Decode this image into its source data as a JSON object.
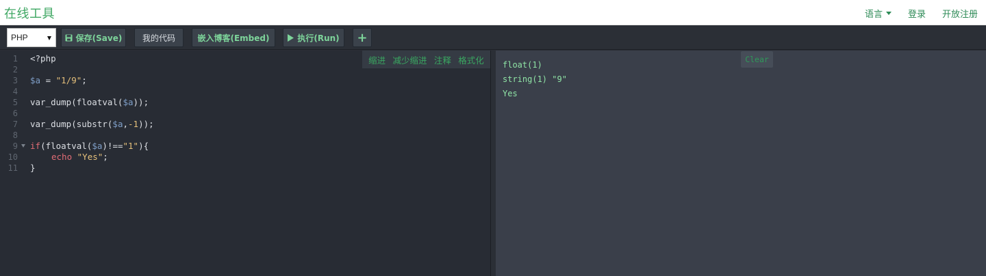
{
  "header": {
    "brand": "在线工具",
    "nav": [
      {
        "label": "语言",
        "has_caret": true
      },
      {
        "label": "登录"
      },
      {
        "label": "开放注册"
      }
    ]
  },
  "toolbar": {
    "language_select": {
      "value": "PHP",
      "icon": "chevron-down-icon"
    },
    "save_label": "保存(Save)",
    "save_icon": "floppy-disk-icon",
    "my_code_label": "我的代码",
    "embed_label": "嵌入博客(Embed)",
    "run_label": "执行(Run)",
    "run_icon": "play-icon",
    "add_label": "+",
    "accent_color": "#7dd49a"
  },
  "editor": {
    "tools": [
      "缩进",
      "减少缩进",
      "注释",
      "格式化"
    ],
    "line_numbers": [
      "1",
      "2",
      "3",
      "4",
      "5",
      "6",
      "7",
      "8",
      "9",
      "10",
      "11"
    ],
    "code": {
      "l1": "<?php",
      "l3_var": "$a",
      "l3_eq": " = ",
      "l3_str": "\"1/9\"",
      "l3_end": ";",
      "l5_pre": "var_dump(floatval(",
      "l5_var": "$a",
      "l5_post": "));",
      "l7_pre": "var_dump(substr(",
      "l7_var": "$a",
      "l7_comma": ",",
      "l7_num": "-1",
      "l7_post": "));",
      "l9_kw": "if",
      "l9_pre": "(floatval(",
      "l9_var": "$a",
      "l9_mid": ")!==",
      "l9_str": "\"1\"",
      "l9_post": "){",
      "l10_kw": "echo",
      "l10_str": "\"Yes\"",
      "l10_end": ";",
      "l11": "}"
    }
  },
  "output": {
    "clear_label": "Clear",
    "lines": [
      "float(1)",
      "string(1) \"9\"",
      "Yes"
    ]
  }
}
